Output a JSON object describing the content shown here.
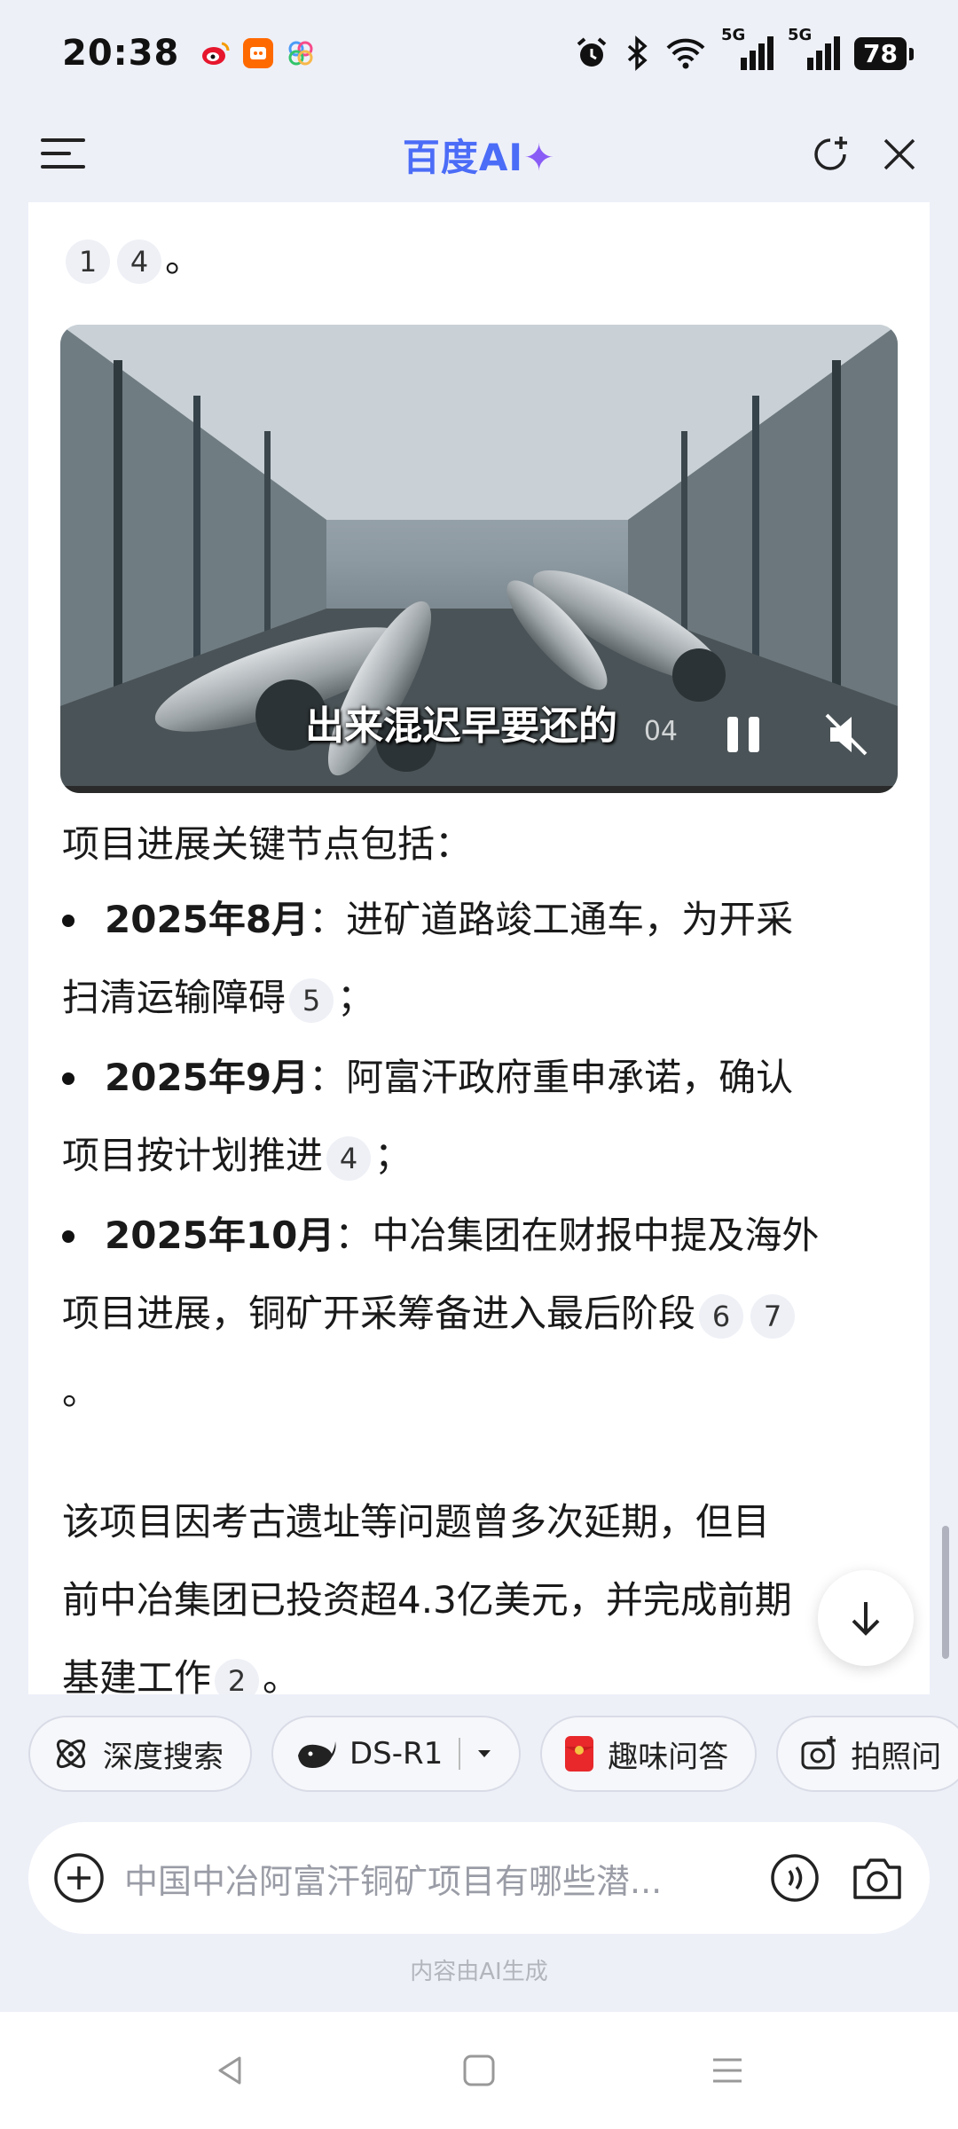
{
  "status_bar": {
    "time": "20:38",
    "signal1": "5G",
    "signal2": "5G",
    "battery": "78"
  },
  "header": {
    "brand": "百度AI",
    "brand_star": "✦"
  },
  "content": {
    "top_refs": [
      "1",
      "4"
    ],
    "top_period": "。",
    "video": {
      "subtitle": "出来混迟早要还的",
      "time": "04"
    },
    "intro": "项目进展关键节点包括：",
    "bullets": [
      {
        "date": "2025年8月",
        "sep": "：",
        "text1": "进矿道路竣工通车，为开采",
        "text2": "扫清运输障碍",
        "refs": [
          "5"
        ],
        "end": "；"
      },
      {
        "date": "2025年9月",
        "sep": "：",
        "text1": "阿富汗政府重申承诺，确认",
        "text2": "项目按计划推进",
        "refs": [
          "4"
        ],
        "end": "；"
      },
      {
        "date": "2025年10月",
        "sep": "：",
        "text1": "中冶集团在财报中提及海外",
        "text2": "项目进展，铜矿开采筹备进入最后阶段",
        "refs": [
          "6",
          "7"
        ],
        "end": "。"
      }
    ],
    "closing_line1": "该项目因考古遗址等问题曾多次延期，但目",
    "closing_line2": "前中冶集团已投资超4.3亿美元，并完成前期",
    "closing_line3": "基建工作",
    "closing_refs": [
      "2"
    ],
    "closing_end": "。"
  },
  "chips": [
    {
      "label": "深度搜索",
      "icon": "atom-icon"
    },
    {
      "label": "DS-R1",
      "icon": "whale-icon"
    },
    {
      "label": "趣味问答",
      "icon": "red-envelope-icon"
    },
    {
      "label": "拍照问",
      "icon": "camera-plus-icon"
    }
  ],
  "input": {
    "placeholder": "中国中冶阿富汗铜矿项目有哪些潜..."
  },
  "footer_note": "内容由AI生成",
  "colors": {
    "brand": "#4b6cf7",
    "accent_purple": "#8a5cf6",
    "background": "#eef0f8"
  }
}
